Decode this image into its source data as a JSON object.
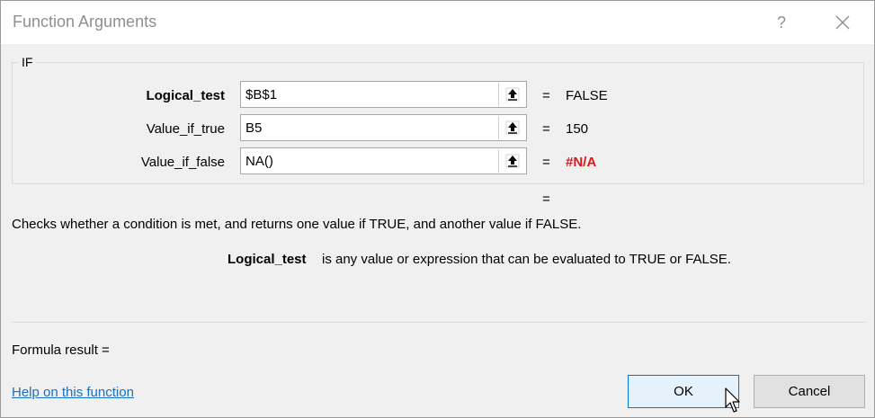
{
  "window": {
    "title": "Function Arguments",
    "help_glyph": "?",
    "close_icon": "close-icon"
  },
  "function": {
    "name": "IF",
    "arguments": [
      {
        "label": "Logical_test",
        "value": "$B$1",
        "equals": "=",
        "result": "FALSE",
        "bold": true
      },
      {
        "label": "Value_if_true",
        "value": "B5",
        "equals": "=",
        "result": "150",
        "bold": false
      },
      {
        "label": "Value_if_false",
        "value": "NA()",
        "equals": "=",
        "result": "#N/A",
        "bold": false,
        "result_color": "#e0161b"
      }
    ],
    "overall_equals": "=",
    "description": "Checks whether a condition is met, and returns one value if TRUE, and another value if FALSE.",
    "argument_help": {
      "name": "Logical_test",
      "text": "is any value or expression that can be evaluated to TRUE or FALSE."
    }
  },
  "footer": {
    "formula_result": "Formula result =",
    "help_link": "Help on this function",
    "ok_label": "OK",
    "cancel_label": "Cancel"
  },
  "colors": {
    "link": "#1a6fc1",
    "error": "#e0161b",
    "ok_border": "#0078d7",
    "ok_bg": "#e5f1fb"
  }
}
